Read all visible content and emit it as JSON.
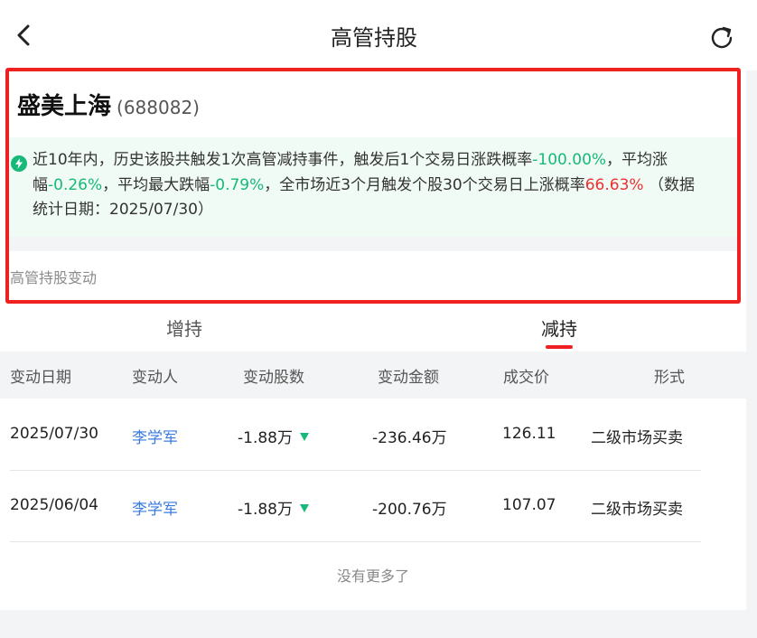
{
  "header": {
    "title": "高管持股"
  },
  "stock": {
    "name": "盛美上海",
    "code": "(688082)"
  },
  "stat": {
    "t1": "近10年内，历史该股共触发1次高管减持事件，触发后1个交易日涨跌概率",
    "v1": "-100.00%",
    "t2": "，平均涨幅",
    "v2": "-0.26%",
    "t3": "，平均最大跌幅",
    "v3": "-0.79%",
    "t4": "，全市场近3个月触发个股30个交易日上涨概率",
    "v4": "66.63%",
    "t5": " （数据统计日期：2025/07/30）"
  },
  "section_label": "高管持股变动",
  "tabs": {
    "add": "增持",
    "reduce": "减持",
    "active": "reduce"
  },
  "table": {
    "headers": [
      "变动日期",
      "变动人",
      "变动股数",
      "变动金额",
      "成交价",
      "形式"
    ],
    "rows": [
      {
        "date": "2025/07/30",
        "person": "李学军",
        "shares": "-1.88万",
        "amount": "-236.46万",
        "price": "126.11",
        "form": "二级市场买卖"
      },
      {
        "date": "2025/06/04",
        "person": "李学军",
        "shares": "-1.88万",
        "amount": "-200.76万",
        "price": "107.07",
        "form": "二级市场买卖"
      }
    ]
  },
  "no_more": "没有更多了",
  "colors": {
    "accent_red": "#ee2020",
    "up_red": "#ee3030",
    "down_green": "#17b978",
    "link_blue": "#3a7be0"
  },
  "icons": {
    "back": "chevron-left-icon",
    "refresh": "refresh-icon",
    "stat": "lightning-icon",
    "down": "triangle-down-icon"
  }
}
